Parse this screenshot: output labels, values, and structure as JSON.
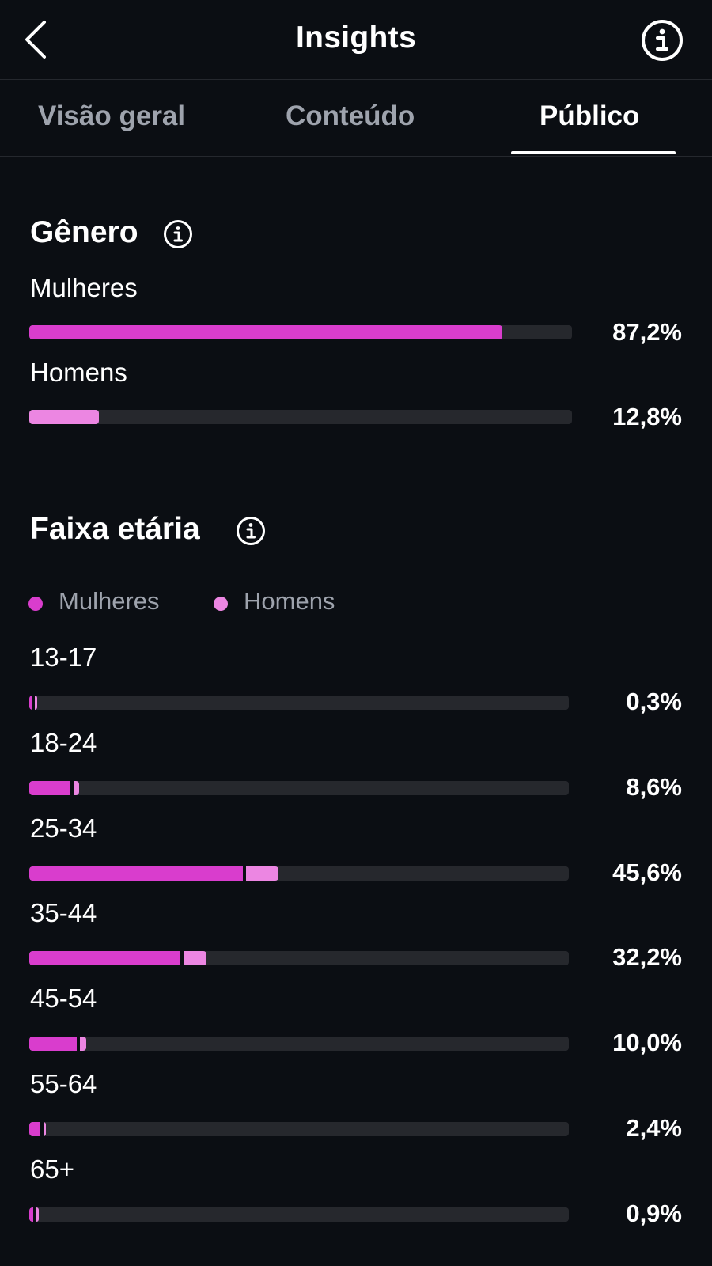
{
  "header": {
    "title": "Insights",
    "back_icon": "chevron-left-icon",
    "info_icon": "info-circle-icon"
  },
  "tabs": [
    {
      "label": "Visão geral",
      "active": false
    },
    {
      "label": "Conteúdo",
      "active": false
    },
    {
      "label": "Público",
      "active": true
    }
  ],
  "gender": {
    "title": "Gênero",
    "info_icon": "info-circle-icon",
    "rows": [
      {
        "label": "Mulheres",
        "percent_text": "87,2%",
        "value": 87.2,
        "color": "#d93dcd"
      },
      {
        "label": "Homens",
        "percent_text": "12,8%",
        "value": 12.8,
        "color": "#ec86e2"
      }
    ]
  },
  "age": {
    "title": "Faixa etária",
    "info_icon": "info-circle-icon",
    "legend": [
      {
        "label": "Mulheres",
        "color": "#d93dcd"
      },
      {
        "label": "Homens",
        "color": "#ec86e2"
      }
    ],
    "rows": [
      {
        "label": "13-17",
        "percent_text": "0,3%",
        "total": 0.3,
        "women": 0.25,
        "men": 0.05
      },
      {
        "label": "18-24",
        "percent_text": "8,6%",
        "total": 8.6,
        "women": 7.6,
        "men": 1.0
      },
      {
        "label": "25-34",
        "percent_text": "45,6%",
        "total": 45.6,
        "women": 39.6,
        "men": 6.0
      },
      {
        "label": "35-44",
        "percent_text": "32,2%",
        "total": 32.2,
        "women": 28.0,
        "men": 4.2
      },
      {
        "label": "45-54",
        "percent_text": "10,0%",
        "total": 10.0,
        "women": 8.8,
        "men": 1.2
      },
      {
        "label": "55-64",
        "percent_text": "2,4%",
        "total": 2.4,
        "women": 2.0,
        "men": 0.4
      },
      {
        "label": "65+",
        "percent_text": "0,9%",
        "total": 0.9,
        "women": 0.7,
        "men": 0.2
      }
    ]
  }
}
